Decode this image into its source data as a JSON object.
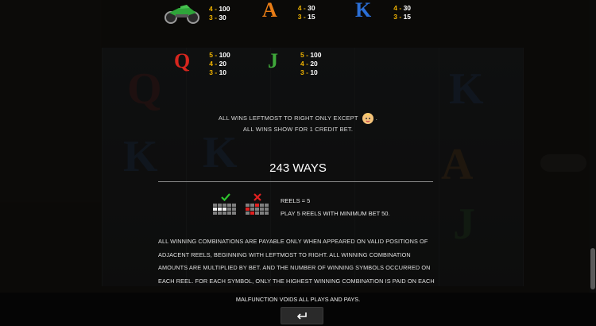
{
  "paytable": {
    "row1": [
      {
        "symbol": "motorcycle-icon",
        "pays": [
          {
            "count": "4",
            "amount": "100"
          },
          {
            "count": "3",
            "amount": "30"
          }
        ]
      },
      {
        "symbol": "A",
        "color": "#e87c15",
        "pays": [
          {
            "count": "4",
            "amount": "30"
          },
          {
            "count": "3",
            "amount": "15"
          }
        ]
      },
      {
        "symbol": "K",
        "color": "#2b6fd6",
        "pays": [
          {
            "count": "4",
            "amount": "30"
          },
          {
            "count": "3",
            "amount": "15"
          }
        ]
      }
    ],
    "row2": [
      {
        "symbol": "Q",
        "color": "#d7261e",
        "pays": [
          {
            "count": "5",
            "amount": "100"
          },
          {
            "count": "4",
            "amount": "20"
          },
          {
            "count": "3",
            "amount": "10"
          }
        ]
      },
      {
        "symbol": "J",
        "color": "#3fa83a",
        "pays": [
          {
            "count": "5",
            "amount": "100"
          },
          {
            "count": "4",
            "amount": "20"
          },
          {
            "count": "3",
            "amount": "10"
          }
        ]
      }
    ],
    "dash": "-"
  },
  "notes": {
    "wins_left": "ALL WINS LEFTMOST TO RIGHT ONLY EXCEPT",
    "wins_left_suffix": ".",
    "credit_bet": "ALL WINS SHOW FOR 1 CREDIT BET."
  },
  "ways": {
    "title": "243 WAYS",
    "reels": "REELS = 5",
    "play": "PLAY 5 REELS WITH MINIMUM BET 50."
  },
  "rules_paragraph": "ALL WINNING COMBINATIONS ARE PAYABLE ONLY WHEN APPEARED ON VALID POSITIONS OF ADJACENT REELS, BEGINNING WITH LEFTMOST TO RIGHT. ALL WINNING COMBINATION AMOUNTS ARE MULTIPLIED BY BET. AND THE NUMBER OF WINNING SYMBOLS OCCURRED ON EACH REEL. FOR EACH SYMBOL, ONLY THE HIGHEST WINNING COMBINATION IS PAID ON EACH SPIN.",
  "footer": {
    "malfunction": "MALFUNCTION VOIDS ALL PLAYS AND PAYS."
  },
  "colors": {
    "pay_count": "#f0b300",
    "accent_green": "#2ec52e",
    "accent_red": "#e02020"
  }
}
